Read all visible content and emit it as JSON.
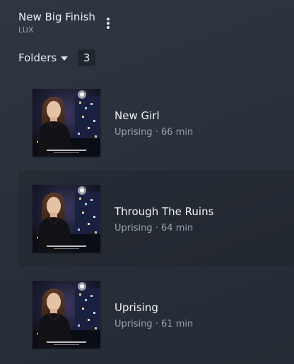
{
  "header": {
    "title": "New Big Finish",
    "subtitle": "LUX",
    "more_icon": "more-vertical-icon"
  },
  "folders": {
    "label": "Folders",
    "count": "3"
  },
  "items": [
    {
      "title": "New Girl",
      "album": "Uprising",
      "separator": "·",
      "duration": "66 min",
      "artwork": "album-artwork"
    },
    {
      "title": "Through The Ruins",
      "album": "Uprising",
      "separator": "·",
      "duration": "64 min",
      "artwork": "album-artwork"
    },
    {
      "title": "Uprising",
      "album": "Uprising",
      "separator": "·",
      "duration": "61 min",
      "artwork": "album-artwork"
    }
  ],
  "colors": {
    "background": "#2a313b",
    "text_primary": "#f2f4f6",
    "text_secondary": "#9aa3ad",
    "badge_bg": "#20262e"
  }
}
